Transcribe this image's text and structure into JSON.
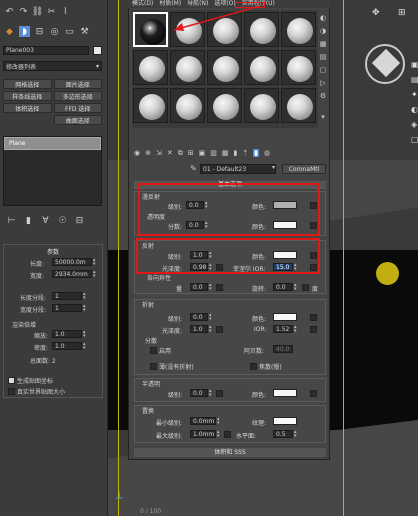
{
  "toolbar": {
    "icons": [
      "undo-icon",
      "redo-icon",
      "link-icon",
      "unlink-icon",
      "bind-icon"
    ]
  },
  "object": {
    "name": "Plane003",
    "modifier_list": "修改器列表"
  },
  "rollout_buttons": [
    [
      "网格选择",
      "面片选择"
    ],
    [
      "样条线选择",
      "多边形选择"
    ],
    [
      "体积选择",
      "FFD 选择"
    ],
    [
      "",
      "曲面选择"
    ]
  ],
  "stack": {
    "item": "Plane"
  },
  "params": {
    "title": "参数",
    "length_label": "长度:",
    "length_value": "50000.0m",
    "width_label": "宽度:",
    "width_value": "2934.0mm",
    "length_segs_label": "长度分段:",
    "length_segs_value": "1",
    "width_segs_label": "宽度分段:",
    "width_segs_value": "1",
    "render_mult_label": "渲染倍增",
    "scale_label": "缩放:",
    "scale_value": "1.0",
    "density_label": "密度:",
    "density_value": "1.0",
    "total_faces_label": "总面数: 2",
    "gen_map_label": "生成贴图坐标",
    "real_world_label": "真实世界贴图大小"
  },
  "material_editor": {
    "menus": [
      "模式(D)",
      "材质(M)",
      "导航(N)",
      "选项(O)",
      "实用程序(U)"
    ],
    "material_name": "01 - Default23",
    "material_type": "CoronaMtl",
    "basic_section": "基本选项",
    "diffuse": {
      "title": "漫反射",
      "level_label": "级别:",
      "level_value": "0.0",
      "color_label": "颜色:",
      "translucency_label": "透明度",
      "fraction_label": "分数:",
      "fraction_value": "0.0",
      "color2_label": "颜色:"
    },
    "reflect": {
      "title": "反射",
      "level_label": "级别:",
      "level_value": "1.0",
      "color_label": "颜色:",
      "gloss_label": "光泽度:",
      "gloss_value": "0.98",
      "fresnel_label": "菲涅尔 IOR:",
      "fresnel_value": "15.0",
      "aniso_label": "各向异性",
      "amount_label": "量",
      "amount_value": "0.0",
      "rotation_label": "旋转:",
      "rotation_value": "0.0",
      "deg_label": "度"
    },
    "refract": {
      "title": "折射",
      "level_label": "级别:",
      "level_value": "0.0",
      "color_label": "颜色:",
      "gloss_label": "光泽度:",
      "gloss_value": "1.0",
      "ior_label": "IOR:",
      "ior_value": "1.52",
      "dispersion_label": "分散",
      "enable_label": "启用",
      "abbe_label": "阿贝数:",
      "abbe_value": "40.0",
      "thin_label": "薄(没有折射)",
      "caustics_label": "焦散(慢)"
    },
    "translucent": {
      "title": "半透明",
      "level_label": "级别:",
      "level_value": "0.0",
      "color_label": "颜色:"
    },
    "displace": {
      "title": "置换",
      "min_label": "最小级别:",
      "min_value": "0.0mm",
      "texture_label": "纹理:",
      "max_label": "最大级别:",
      "max_value": "1.0mm",
      "water_label": "水平面:",
      "water_value": "0.5"
    },
    "volume_section": "体积和 SSS"
  },
  "status": {
    "frame": "0 / 100"
  },
  "colors": {
    "highlight_red": "#e01818",
    "selected_blue": "#5a8fd8",
    "viewport_yellow": "#c9b400"
  }
}
